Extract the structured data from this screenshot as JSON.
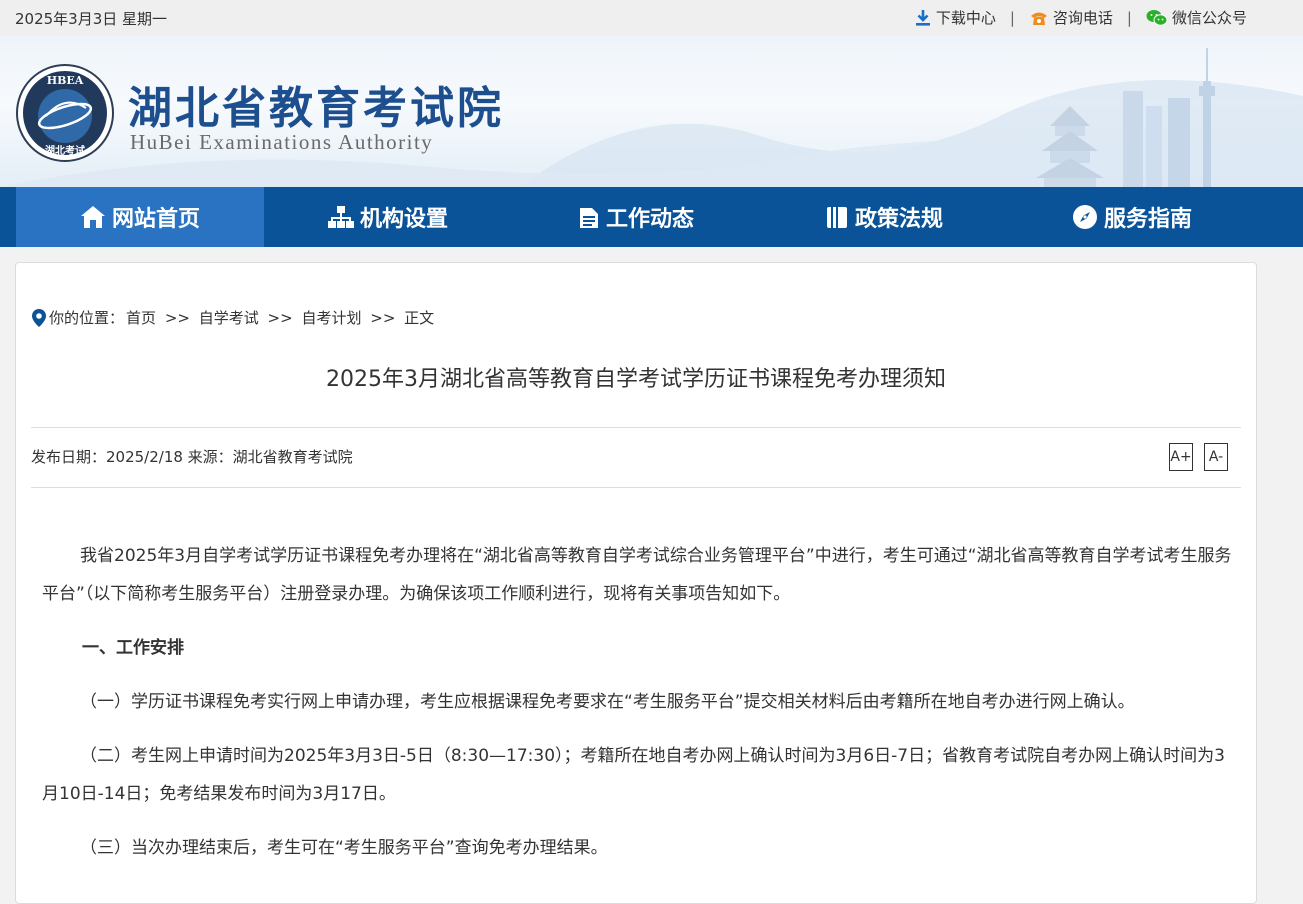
{
  "topbar": {
    "date": "2025年3月3日 星期一",
    "links": [
      {
        "label": "下载中心",
        "icon": "download-icon"
      },
      {
        "label": "咨询电话",
        "icon": "phone-icon"
      },
      {
        "label": "微信公众号",
        "icon": "wechat-icon"
      }
    ],
    "separator": "|"
  },
  "banner": {
    "emblem_text_top": "HBEA",
    "emblem_text_bottom": "湖北考试",
    "title_cn": "湖北省教育考试院",
    "title_en": "HuBei Examinations Authority"
  },
  "nav": {
    "items": [
      {
        "label": "网站首页",
        "icon": "home-icon",
        "active": true
      },
      {
        "label": "机构设置",
        "icon": "org-chart-icon"
      },
      {
        "label": "工作动态",
        "icon": "document-icon"
      },
      {
        "label": "政策法规",
        "icon": "book-icon"
      },
      {
        "label": "服务指南",
        "icon": "compass-icon"
      }
    ]
  },
  "breadcrumb": {
    "prefix": "你的位置：",
    "items": [
      "首页",
      "自学考试",
      "自考计划",
      "正文"
    ],
    "separator": ">>"
  },
  "article": {
    "title": "2025年3月湖北省高等教育自学考试学历证书课程免考办理须知",
    "meta": "发布日期：2025/2/18 来源：湖北省教育考试院",
    "font_increase": "A+",
    "font_decrease": "A-",
    "paragraphs": [
      "我省2025年3月自学考试学历证书课程免考办理将在“湖北省高等教育自学考试综合业务管理平台”中进行，考生可通过“湖北省高等教育自学考试考生服务平台”（以下简称考生服务平台）注册登录办理。为确保该项工作顺利进行，现将有关事项告知如下。",
      "一、工作安排",
      "（一）学历证书课程免考实行网上申请办理，考生应根据课程免考要求在“考生服务平台”提交相关材料后由考籍所在地自考办进行网上确认。",
      "（二）考生网上申请时间为2025年3月3日-5日（8:30—17:30）；考籍所在地自考办网上确认时间为3月6日-7日；省教育考试院自考办网上确认时间为3月10日-14日；免考结果发布时间为3月17日。",
      "（三）当次办理结束后，考生可在“考生服务平台”查询免考办理结果。"
    ]
  },
  "colors": {
    "nav_bg": "#0a5399",
    "nav_active": "#2a72c2",
    "brand_text": "#1d4f8f",
    "download_icon": "#1a6fc9",
    "phone_icon": "#f08c1e",
    "wechat_icon": "#2bb02b",
    "location_icon": "#0a5399"
  }
}
